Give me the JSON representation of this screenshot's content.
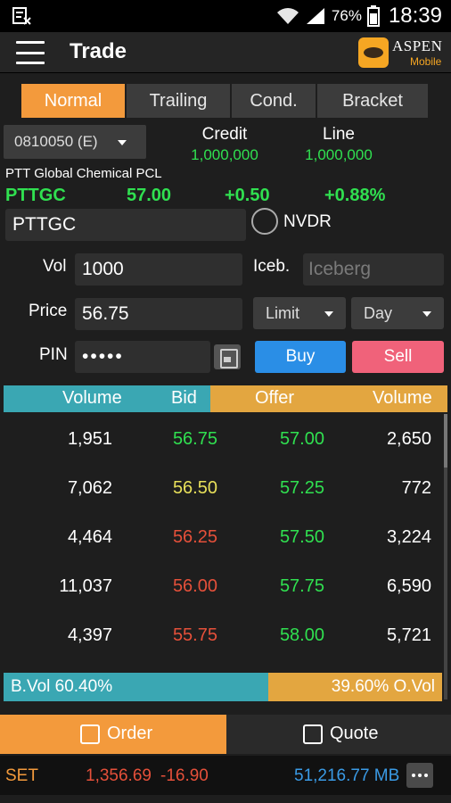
{
  "status_bar": {
    "battery_pct": "76%",
    "time": "18:39",
    "icons": [
      "notification-icon",
      "wifi-icon",
      "signal-icon",
      "battery-icon"
    ]
  },
  "app_bar": {
    "title": "Trade",
    "logo_text": "ASPEN",
    "logo_sub": "Mobile"
  },
  "order_tabs": [
    "Normal",
    "Trailing",
    "Cond.",
    "Bracket"
  ],
  "active_tab": "Normal",
  "account": {
    "selected": "0810050 (E)",
    "credit_label": "Credit",
    "credit_value": "1,000,000",
    "line_label": "Line",
    "line_value": "1,000,000"
  },
  "stock": {
    "company_name": "PTT Global Chemical PCL",
    "symbol": "PTTGC",
    "last": "57.00",
    "change": "+0.50",
    "pct_change": "+0.88%"
  },
  "form": {
    "symbol_value": "PTTGC",
    "nvdr_label": "NVDR",
    "vol_label": "Vol",
    "vol_value": "1000",
    "iceberg_label": "Iceb.",
    "iceberg_placeholder": "Iceberg",
    "price_label": "Price",
    "price_value": "56.75",
    "price_type": "Limit",
    "validity": "Day",
    "pin_label": "PIN",
    "pin_value": "•••••",
    "buy_label": "Buy",
    "sell_label": "Sell"
  },
  "order_book": {
    "headers": {
      "bid_volume": "Volume",
      "bid": "Bid",
      "offer": "Offer",
      "offer_volume": "Volume"
    },
    "rows": [
      {
        "bid_volume": "1,951",
        "bid": "56.75",
        "offer": "57.00",
        "offer_volume": "2,650",
        "bid_color": "#30e050"
      },
      {
        "bid_volume": "7,062",
        "bid": "56.50",
        "offer": "57.25",
        "offer_volume": "772",
        "bid_color": "#e8e05a"
      },
      {
        "bid_volume": "4,464",
        "bid": "56.25",
        "offer": "57.50",
        "offer_volume": "3,224",
        "bid_color": "#e5503a"
      },
      {
        "bid_volume": "11,037",
        "bid": "56.00",
        "offer": "57.75",
        "offer_volume": "6,590",
        "bid_color": "#e5503a"
      },
      {
        "bid_volume": "4,397",
        "bid": "55.75",
        "offer": "58.00",
        "offer_volume": "5,721",
        "bid_color": "#e5503a"
      }
    ]
  },
  "ratio": {
    "bid_label": "B.Vol 60.40%",
    "offer_label": "39.60% O.Vol",
    "bid_fraction": 0.604
  },
  "bottom_tabs": {
    "order_label": "Order",
    "quote_label": "Quote"
  },
  "ticker": {
    "market": "SET",
    "index": "1,356.69",
    "change": "-16.90",
    "value": "51,216.77 MB"
  },
  "colors": {
    "accent": "#f39a3c",
    "bid_teal": "#3aa7b3",
    "offer_orange": "#e3a640",
    "up_green": "#30e050",
    "down_red": "#e5503a",
    "buy_blue": "#2a8ee6",
    "sell_pink": "#f0627a",
    "ticker_blue": "#3a9be6"
  }
}
